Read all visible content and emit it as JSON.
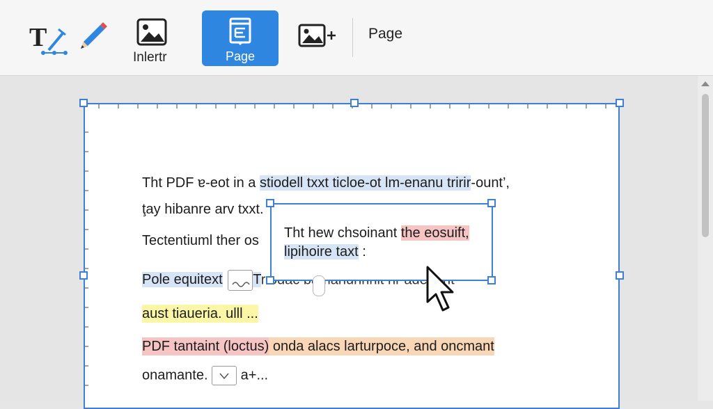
{
  "toolbar": {
    "insert_label": "Inlertr",
    "page_label": "Page",
    "page_text": "Page"
  },
  "document": {
    "line1": {
      "a": "Tht PDF ɐ-eot in a ",
      "b": "stiodell txxt ticloe-ot lm-enanu tririr",
      "c": "-ount’,"
    },
    "line2": "ţay hibanre arv txxt.",
    "line3": "Tectentiuml ther os",
    "line4": {
      "a": "Pole equitext",
      "b": "T",
      "c": "r odac bamanunnnit nr adenant"
    },
    "line5": "aust tiaueria. ulll ...",
    "line6": {
      "a": "PDF tantaint (loctus)",
      "b": " onda alacs larturpoce, and oncmant"
    },
    "line7": {
      "a": "onamante.",
      "b": "a+..."
    },
    "popup": {
      "line1a": "Tht hew chsoinant ",
      "line1b": "the eosuift,",
      "line2a": "lipihoire taxt",
      "line2b": " :"
    }
  },
  "colors": {
    "accent": "#2f86e0",
    "selection": "#3d7fd0",
    "highlight_blue": "#d6e4f5",
    "highlight_yellow": "#fbf7a6",
    "highlight_red": "#f7c4c4",
    "highlight_orange": "#f8d6b6"
  },
  "icons": [
    "text-edit-icon",
    "pencil-icon",
    "image-icon",
    "page-icon",
    "add-image-icon",
    "mouse-cursor-icon"
  ]
}
